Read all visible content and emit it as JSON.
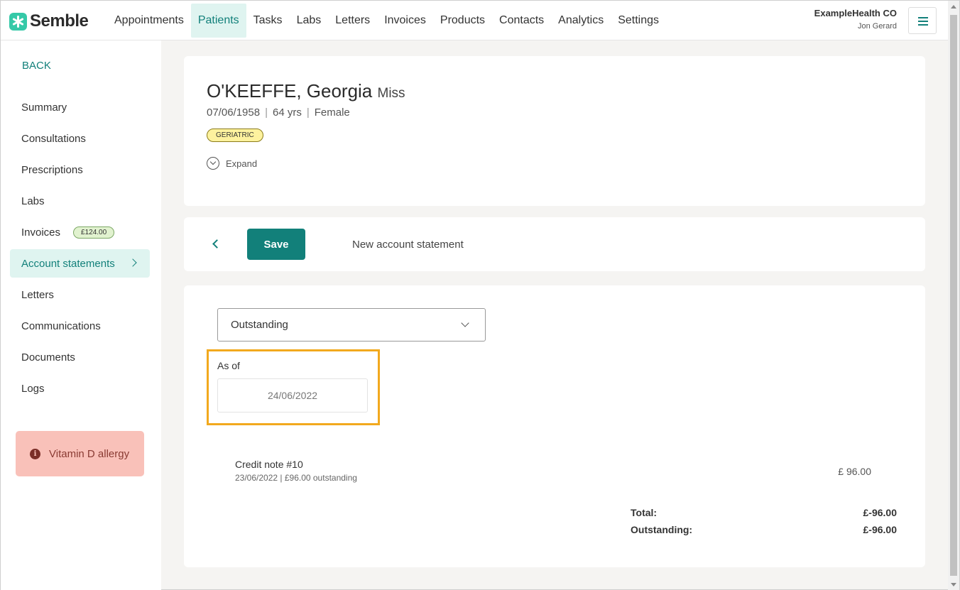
{
  "brand": {
    "name": "Semble",
    "logo_icon": "semble-asterisk-icon",
    "accent": "#12807a",
    "logo_color": "#35c9a8"
  },
  "nav": {
    "items": [
      "Appointments",
      "Patients",
      "Tasks",
      "Labs",
      "Letters",
      "Invoices",
      "Products",
      "Contacts",
      "Analytics",
      "Settings"
    ],
    "active": "Patients"
  },
  "account": {
    "org": "ExampleHealth CO",
    "user": "Jon Gerard",
    "menu_icon": "hamburger-icon"
  },
  "sidebar": {
    "back_label": "BACK",
    "items": [
      {
        "label": "Summary"
      },
      {
        "label": "Consultations"
      },
      {
        "label": "Prescriptions"
      },
      {
        "label": "Labs"
      },
      {
        "label": "Invoices",
        "badge": "£124.00"
      },
      {
        "label": "Account statements",
        "active": true
      },
      {
        "label": "Letters"
      },
      {
        "label": "Communications"
      },
      {
        "label": "Documents"
      },
      {
        "label": "Logs"
      }
    ],
    "alert": {
      "icon": "info-icon",
      "text": "Vitamin D allergy",
      "color": "#f9c1b9"
    }
  },
  "patient": {
    "name": "O'KEEFFE, Georgia",
    "title": "Miss",
    "dob": "07/06/1958",
    "age": "64 yrs",
    "gender": "Female",
    "tag": "GERIATRIC",
    "expand_label": "Expand"
  },
  "toolbar": {
    "save_label": "Save",
    "title": "New account statement"
  },
  "statement": {
    "filter": {
      "value": "Outstanding"
    },
    "as_of": {
      "label": "As of",
      "value": "24/06/2022"
    },
    "rows": [
      {
        "title": "Credit note #10",
        "subtitle": "23/06/2022 | £96.00 outstanding",
        "amount": "£ 96.00"
      }
    ],
    "total_label": "Total:",
    "total_value": "£-96.00",
    "outstanding_label": "Outstanding:",
    "outstanding_value": "£-96.00"
  }
}
